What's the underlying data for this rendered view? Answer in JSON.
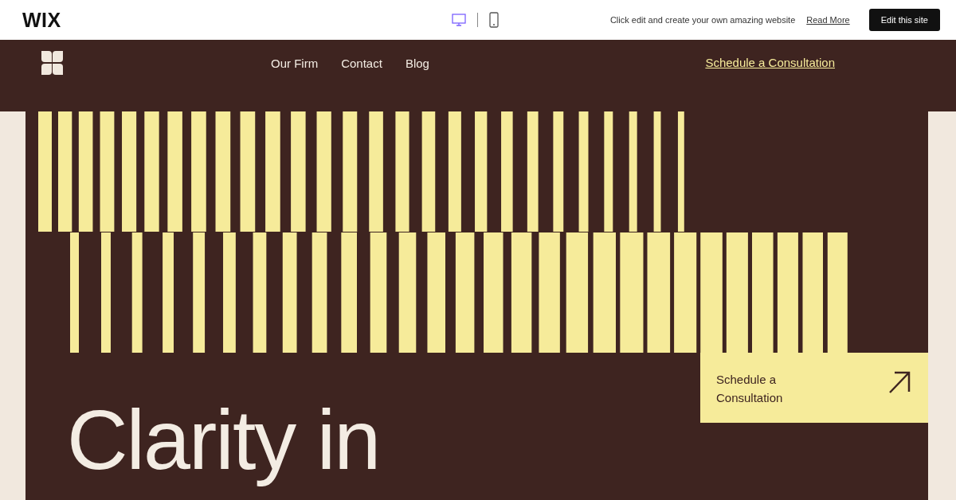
{
  "topbar": {
    "logo": "WIX",
    "view_modes": [
      {
        "kind": "desktop",
        "selected": true
      },
      {
        "kind": "mobile",
        "selected": false
      }
    ],
    "promo": "Click edit and create your own amazing website",
    "link": "Read More",
    "button": "Edit this site"
  },
  "site_header": {
    "nav": [
      "Our Firm",
      "Contact",
      "Blog"
    ],
    "cta": "Schedule a Consultation"
  },
  "hero": {
    "heading": "Clarity in",
    "card": {
      "label": "Schedule a Consultation"
    }
  }
}
